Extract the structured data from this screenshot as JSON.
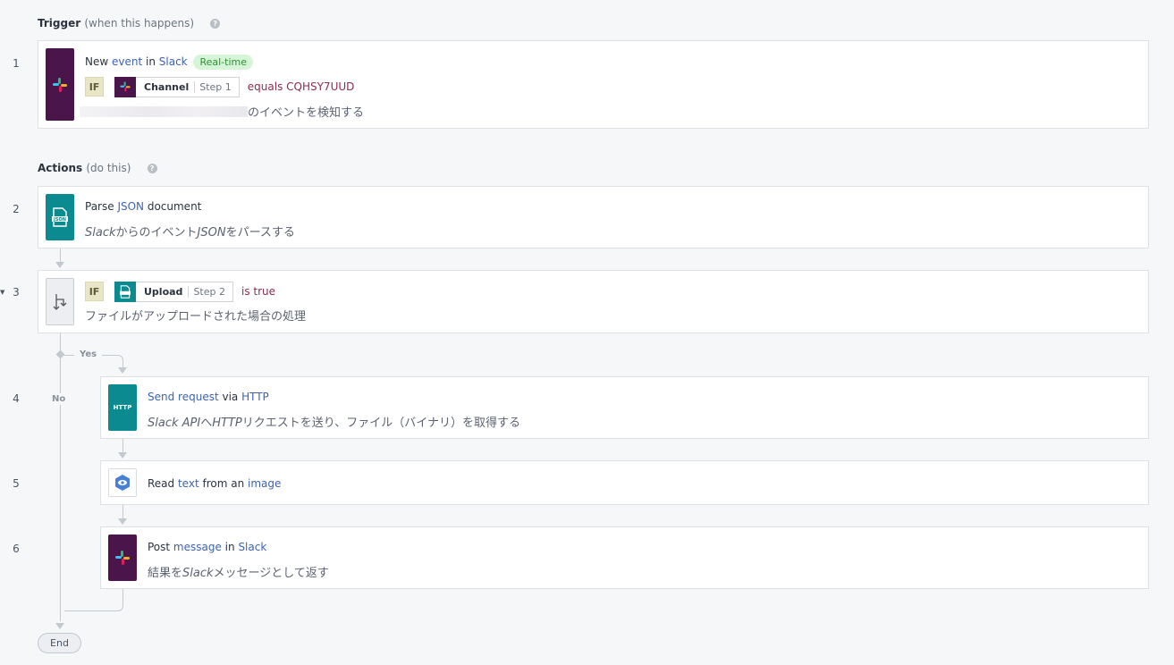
{
  "trigger": {
    "title": "Trigger",
    "subtitle": "(when this happens)",
    "help": "?"
  },
  "actions_header": {
    "title": "Actions",
    "subtitle": "(do this)",
    "help": "?"
  },
  "steps": {
    "s1": {
      "num": "1",
      "pre": "New ",
      "w1": "event",
      "mid": " in ",
      "w2": "Slack",
      "badge": "Real-time",
      "if_label": "IF",
      "field_name": "Channel",
      "field_step": "Step 1",
      "operator": "equals CQHSY7UUD",
      "desc_suffix": "のイベントを検知する"
    },
    "s2": {
      "num": "2",
      "pre": "Parse ",
      "w1": "JSON",
      "post": " document",
      "desc_a": "Slack",
      "desc_b": "からのイベント",
      "desc_c": "JSON",
      "desc_d": "をパースする"
    },
    "s3": {
      "num": "3",
      "if_label": "IF",
      "field_name": "Upload",
      "field_step": "Step 2",
      "operator": "is true",
      "desc": "ファイルがアップロードされた場合の処理"
    },
    "s4": {
      "num": "4",
      "w1": "Send request",
      "mid": " via ",
      "w2": "HTTP",
      "tile_text": "HTTP",
      "desc_a": "Slack API",
      "desc_b": "へ",
      "desc_c": "HTTP",
      "desc_d": "リクエストを送り、ファイル（バイナリ）を取得する"
    },
    "s5": {
      "num": "5",
      "pre": "Read ",
      "w1": "text",
      "mid": " from an ",
      "w2": "image"
    },
    "s6": {
      "num": "6",
      "pre": "Post ",
      "w1": "message",
      "mid": " in ",
      "w2": "Slack",
      "desc_a": "結果を",
      "desc_b": "Slack",
      "desc_c": "メッセージとして返す"
    }
  },
  "branch": {
    "yes": "Yes",
    "no": "No"
  },
  "end_label": "End",
  "icons": {
    "slack": "slack-logo-icon",
    "json": "json-file-icon",
    "branch": "conditional-branch-icon",
    "http": "http-icon",
    "vision": "google-vision-icon"
  },
  "colors": {
    "slack_tile": "#4a154b",
    "teal_tile": "#0b8a8f",
    "link_blue": "#3d63b0",
    "operator": "#8a2d4d",
    "badge_bg": "#d6f5d6",
    "badge_text": "#2f8f3a"
  }
}
